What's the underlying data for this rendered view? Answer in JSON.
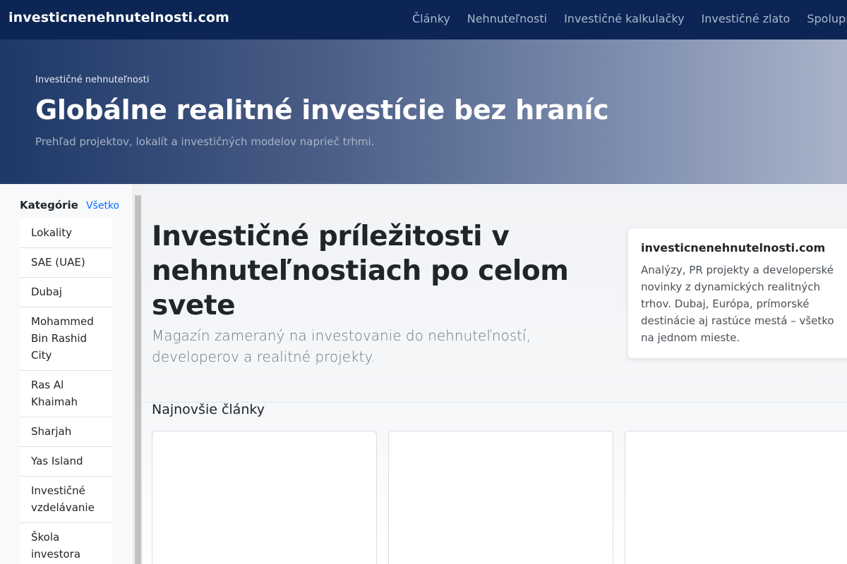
{
  "navbar": {
    "brand": "investicnenehnutelnosti.com",
    "links": [
      "Články",
      "Nehnuteľnosti",
      "Investičné kalkulačky",
      "Investičné zlato",
      "Spolupráca"
    ]
  },
  "hero": {
    "eyebrow": "Investičné nehnuteľnosti",
    "title": "Globálne realitné investície bez hraníc",
    "subtitle": "Prehľad projektov, lokalít a investičných modelov naprieč trhmi."
  },
  "sidebar": {
    "title": "Kategórie",
    "all_link": "Všetko",
    "items": [
      "Lokality",
      "SAE (UAE)",
      "Dubaj",
      "Mohammed Bin Rashid City",
      "Ras Al Khaimah",
      "Sharjah",
      "Yas Island",
      "Investičné vzdelávanie",
      "Škola investora"
    ]
  },
  "main": {
    "title": "Investičné príležitosti v nehnuteľnostiach po celom svete",
    "lead": "Magazín zameraný na investovanie do nehnuteľností, developerov a realitné projekty.",
    "info_card": {
      "title": "investicnenehnutelnosti.com",
      "text": "Analýzy, PR projekty a developerské novinky z dynamických realitných trhov. Dubaj, Európa, prímorské destinácie aj rastúce mestá – všetko na jednom mieste."
    },
    "latest_title": "Najnovšie články"
  },
  "colors": {
    "navbar_bg": "#0c2554",
    "link_blue": "#0d6efd"
  }
}
